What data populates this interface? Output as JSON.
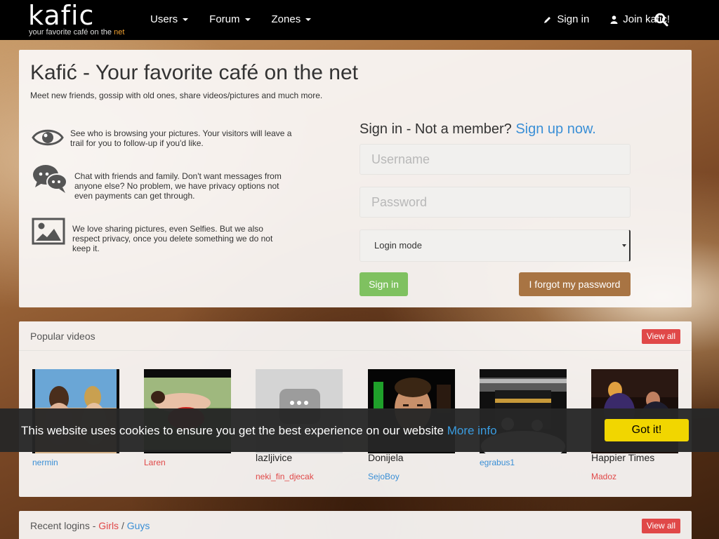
{
  "brand": {
    "logo_text": "kafic",
    "tagline_prefix": "your favorite café on the ",
    "tagline_accent": "net"
  },
  "nav": {
    "menu": [
      {
        "label": "Users"
      },
      {
        "label": "Forum"
      },
      {
        "label": "Zones"
      }
    ],
    "sign_in": "Sign in",
    "join": "Join kafic!"
  },
  "hero": {
    "title": "Kafić - Your favorite café on the net",
    "subtitle": "Meet new friends, gossip with old ones, share videos/pictures and much more.",
    "features": [
      {
        "icon": "eye-icon",
        "text": "See who is browsing your pictures. Your visitors will leave a trail for you to follow-up if you'd like."
      },
      {
        "icon": "chat-icon",
        "text": "Chat with friends and family. Don't want messages from anyone else? No problem, we have privacy options not even payments can get through."
      },
      {
        "icon": "picture-icon",
        "text": "We love sharing pictures, even Selfies. But we also respect privacy, once you delete something we do not keep it."
      }
    ]
  },
  "signin": {
    "title": "Sign in - Not a member?",
    "signup_link": "Sign up now.",
    "username_placeholder": "Username",
    "password_placeholder": "Password",
    "login_mode": "Login mode",
    "submit": "Sign in",
    "forgot": "I forgot my password"
  },
  "videos": {
    "title": "Popular videos",
    "view_all": "View all",
    "items": [
      {
        "title": "",
        "user": "nermin",
        "user_color": "blue"
      },
      {
        "title": "",
        "user": "Laren",
        "user_color": "red"
      },
      {
        "title": "lazljivice",
        "user": "neki_fin_djecak",
        "user_color": "red"
      },
      {
        "title": "Donijela",
        "user": "SejoBoy",
        "user_color": "blue"
      },
      {
        "title": "",
        "user": "egrabus1",
        "user_color": "blue"
      },
      {
        "title": "Happier Times",
        "user": "Madoz",
        "user_color": "red"
      }
    ]
  },
  "recent": {
    "title_prefix": "Recent logins - ",
    "girls": "Girls",
    "separator": " / ",
    "guys": "Guys",
    "view_all": "View all"
  },
  "cookie": {
    "text": "This website uses cookies to ensure you get the best experience on our website",
    "more_info": "More info",
    "button": "Got it!"
  },
  "colors": {
    "link_blue": "#3a8fd6",
    "accent_red": "#e04848",
    "signin_green": "#7fc160",
    "forgot_brown": "#a87443",
    "cookie_yellow": "#f1d600"
  }
}
